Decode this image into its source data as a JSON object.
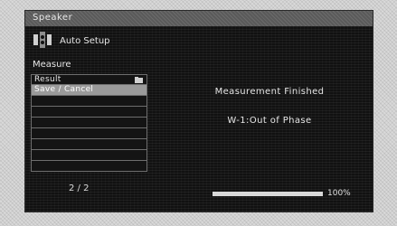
{
  "screen": {
    "title": "Speaker",
    "auto_setup_label": "Auto Setup",
    "measure_label": "Measure",
    "menu_items": [
      {
        "label": "Result",
        "has_folder_icon": true,
        "selected": false
      },
      {
        "label": "Save / Cancel",
        "has_folder_icon": false,
        "selected": true
      },
      {
        "label": ""
      },
      {
        "label": ""
      },
      {
        "label": ""
      },
      {
        "label": ""
      },
      {
        "label": ""
      },
      {
        "label": ""
      },
      {
        "label": ""
      }
    ],
    "page_indicator": "2 / 2",
    "status_message": "Measurement Finished",
    "phase_message": "W-1:Out of Phase",
    "progress_percent": 100,
    "progress_label": "100%"
  },
  "icons": {
    "auto_setup": "speaker-microphone-icon",
    "result": "folder-icon"
  },
  "colors": {
    "screen_bg": "#111111",
    "title_bar": "#5a5a5a",
    "selected_row": "#9a9a9a",
    "text": "#e6e6e6"
  }
}
